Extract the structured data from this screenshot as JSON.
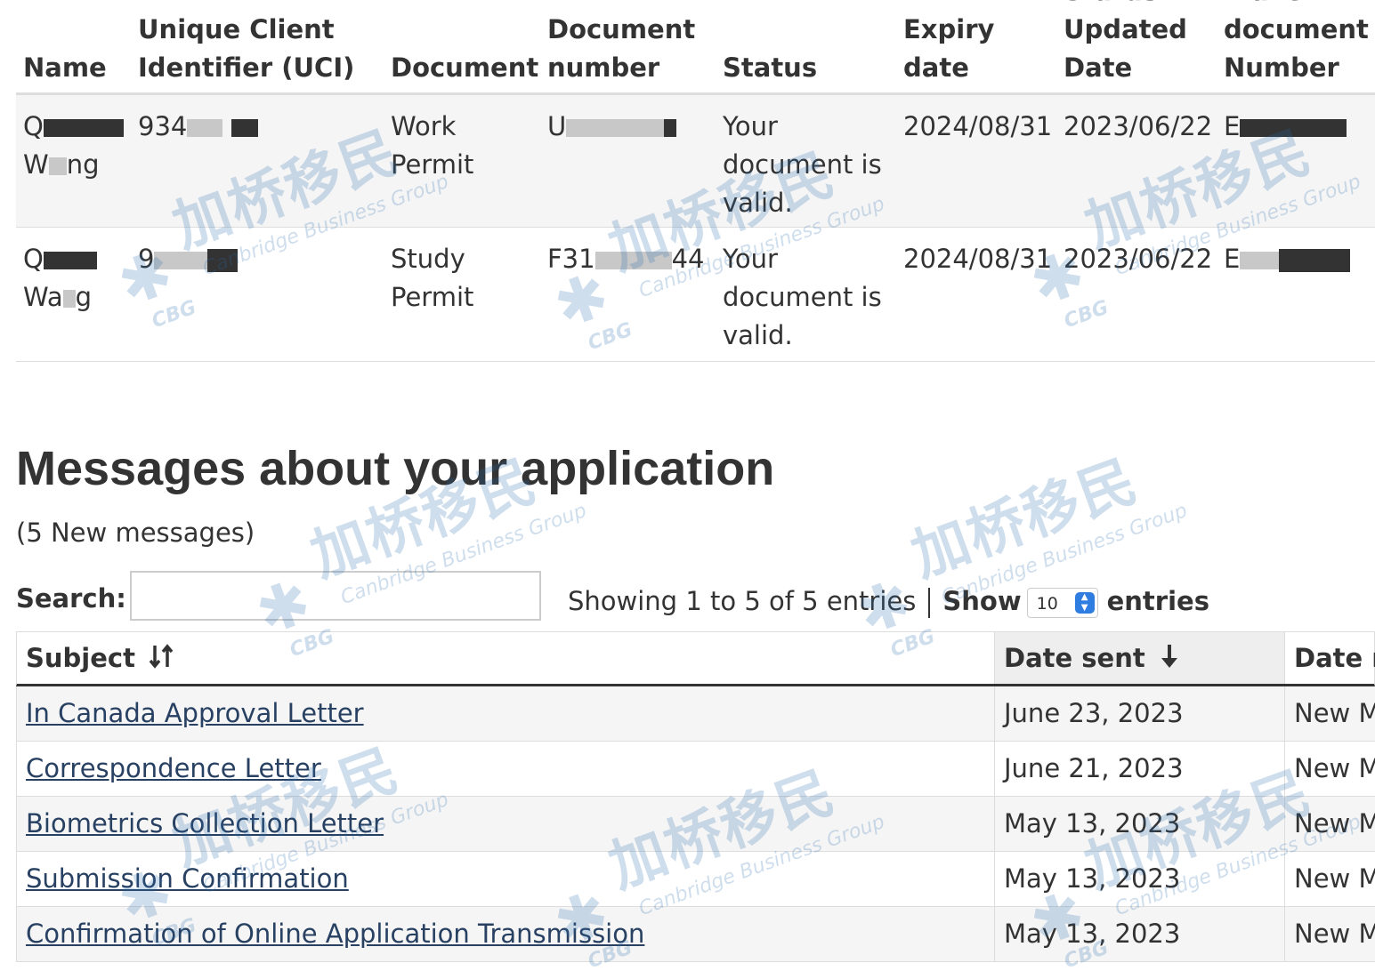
{
  "documents_table": {
    "headers": {
      "name": "Name",
      "uci_1": "Unique Client",
      "uci_2": "Identifier (UCI)",
      "document": "Document",
      "doc_number_1": "Document",
      "doc_number_2": "number",
      "status": "Status",
      "expiry_1": "Expiry",
      "expiry_2": "date",
      "updated_0": "Status",
      "updated_1": "Updated",
      "updated_2": "Date",
      "travel_0": "Travel",
      "travel_1": "document",
      "travel_2": "Number"
    },
    "rows": [
      {
        "name_1": "Q",
        "name_2": "W",
        "name_3": "ng",
        "uci": "934",
        "document_1": "Work",
        "document_2": "Permit",
        "doc_number": "U",
        "status_1": "Your",
        "status_2": "document is",
        "status_3": "valid.",
        "expiry": "2024/08/31",
        "updated": "2023/06/22",
        "travel": "E"
      },
      {
        "name_1": "Q",
        "name_2": "Wa",
        "name_3": "g",
        "uci": "9",
        "document_1": "Study",
        "document_2": "Permit",
        "doc_number_a": "F31",
        "doc_number_b": "44",
        "status_1": "Your",
        "status_2": "document is",
        "status_3": "valid.",
        "expiry": "2024/08/31",
        "updated": "2023/06/22",
        "travel": "E"
      }
    ]
  },
  "messages": {
    "title": "Messages about your application",
    "count": "(5 New messages)",
    "search_label": "Search:",
    "search_value": "",
    "info_text": "Showing 1 to 5 of 5 entries",
    "show_label": "Show",
    "page_length": "10",
    "entries_label": "entries",
    "columns": {
      "subject": "Subject",
      "date_sent": "Date sent",
      "date_read": "Date r"
    },
    "rows": [
      {
        "subject": "In Canada Approval Letter",
        "date_sent": "June 23, 2023",
        "date_read": "New M"
      },
      {
        "subject": "Correspondence Letter",
        "date_sent": "June 21, 2023",
        "date_read": "New M"
      },
      {
        "subject": "Biometrics Collection Letter",
        "date_sent": "May 13, 2023",
        "date_read": "New M"
      },
      {
        "subject": "Submission Confirmation",
        "date_sent": "May 13, 2023",
        "date_read": "New M"
      },
      {
        "subject": "Confirmation of Online Application Transmission",
        "date_sent": "May 13, 2023",
        "date_read": "New M"
      }
    ]
  },
  "watermark": {
    "chinese": "加桥移民",
    "english": "Canbridge Business Group",
    "abbr": "CBG",
    "color": "#2a6bb0"
  },
  "colors": {
    "link": "#284162",
    "sorted_header": "#eeeeee",
    "stripe": "#f5f5f5",
    "spinner": "#2f7de1"
  },
  "icons": {
    "subject_sort": "sort-both-icon",
    "date_sort": "arrow-down-icon"
  }
}
